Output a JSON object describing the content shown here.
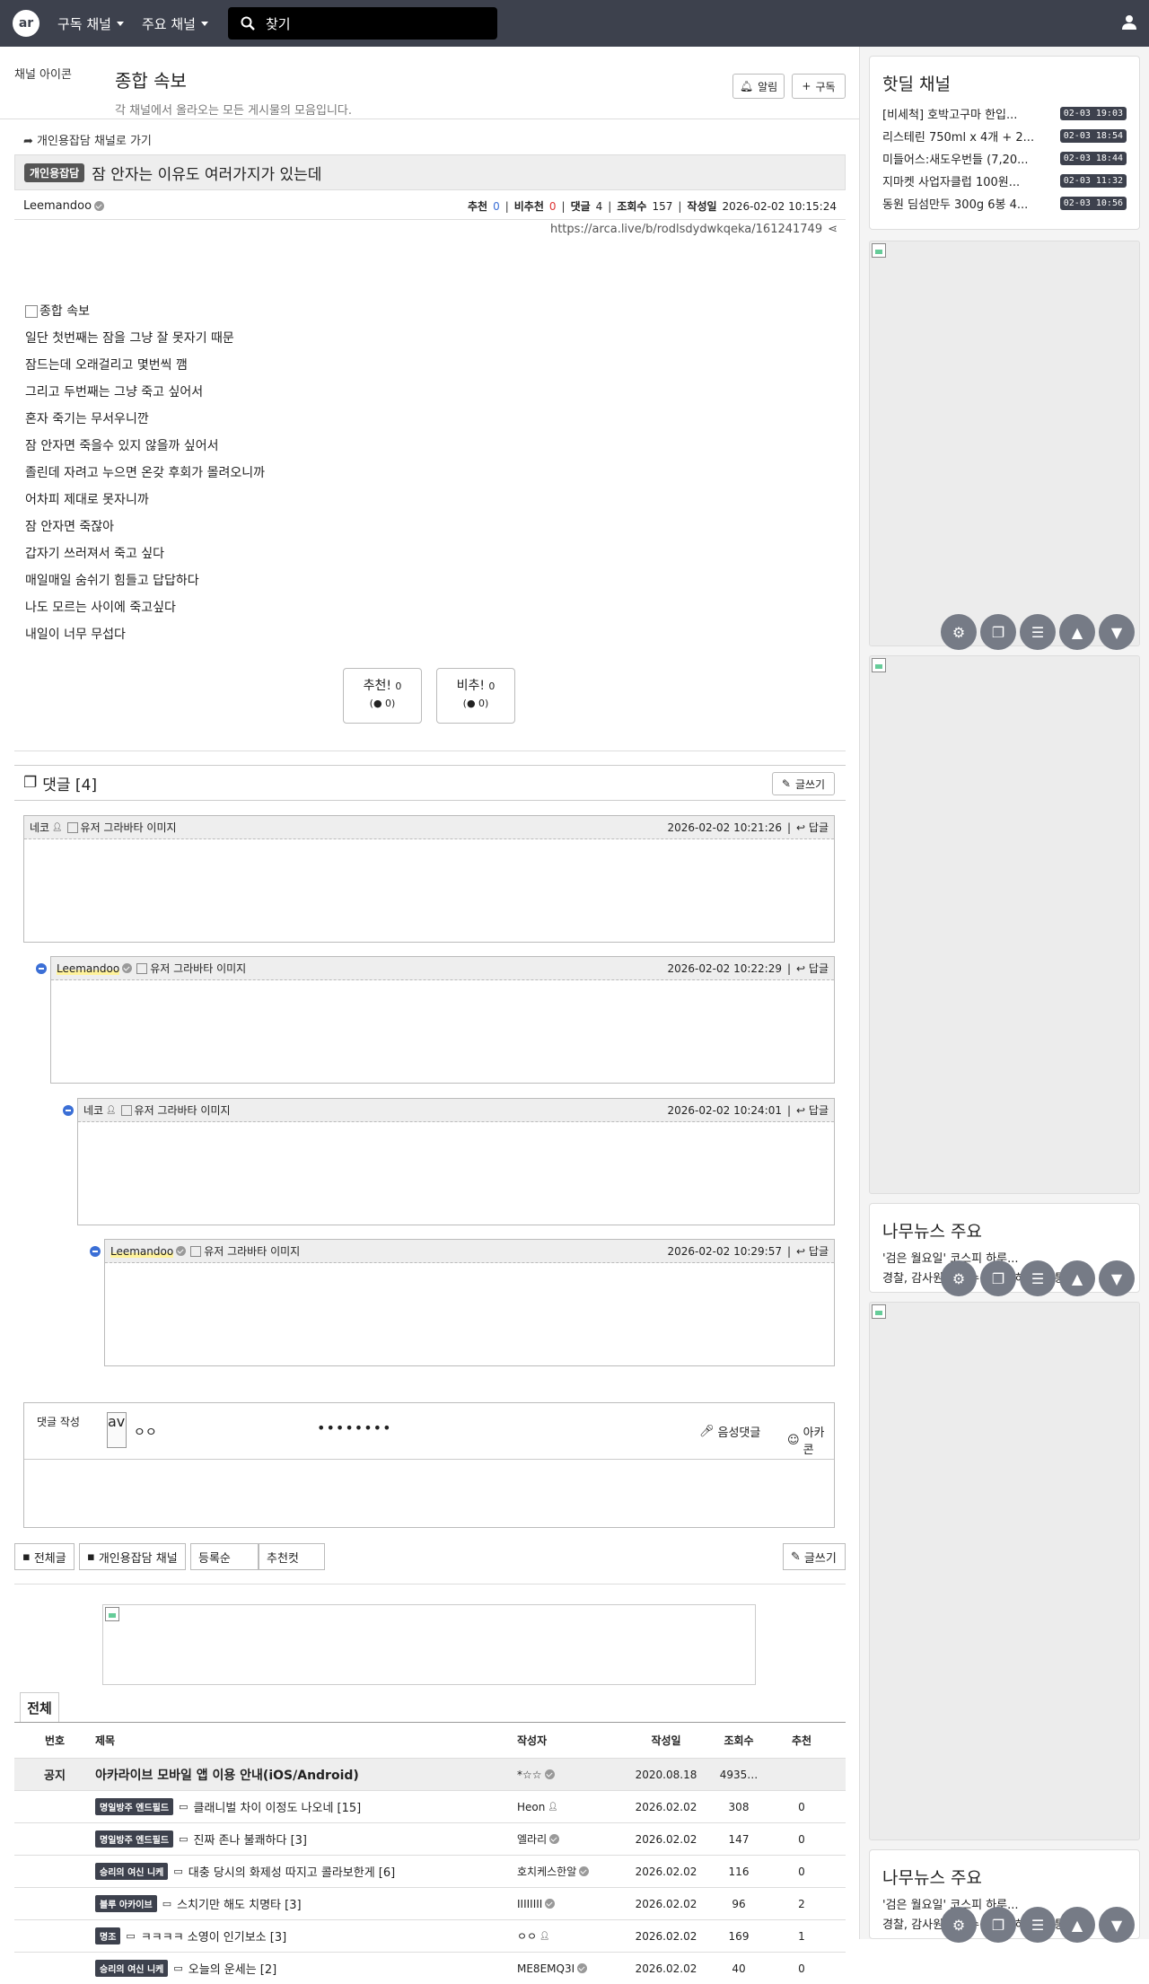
{
  "topbar": {
    "logo": "ar",
    "nav1": "구독 채널",
    "nav2": "주요 채널",
    "search_placeholder": "찾기"
  },
  "channel": {
    "img_alt": "채널 아이콘",
    "title": "종합 속보",
    "desc": "각 채널에서 올라오는 모든 게시물의 모음입니다.",
    "alarm": "알림",
    "subscribe": "구독"
  },
  "post": {
    "back_link": "개인용잡담 채널로 가기",
    "category": "개인용잡담",
    "title": "잠 안자는 이유도 여러가지가 있는데",
    "author": "Leemandoo",
    "labels": {
      "rec": "추천",
      "unrec": "비추천",
      "comments": "댓글",
      "views": "조회수",
      "date": "작성일"
    },
    "rec": "0",
    "unrec": "0",
    "comments": "4",
    "views": "157",
    "date": "2026-02-02 10:15:24",
    "url": "https://arca.live/b/rodlsdydwkqeka/161241749",
    "img_alt": "종합 속보",
    "lines": [
      "일단 첫번째는 잠을 그냥 잘 못자기 때문",
      "잠드는데 오래걸리고 몇번씩 깸",
      "그리고 두번째는 그냥 죽고 싶어서",
      "혼자 죽기는 무서우니깐",
      "잠 안자면 죽을수 있지 않을까 싶어서",
      "졸린데 자려고 누으면 온갖 후회가 몰려오니까",
      "어차피 제대로 못자니까",
      "잠 안자면 죽잖아",
      "갑자기 쓰러져서 죽고 싶다",
      "매일매일 숨쉬기 힘들고 답답하다",
      "나도 모르는 사이에 죽고싶다",
      "내일이 너무 무섭다"
    ],
    "vote_up": "추천!",
    "vote_up_n": "0",
    "vote_up_sub": "0",
    "vote_down": "비추!",
    "vote_down_n": "0",
    "vote_down_sub": "0"
  },
  "comments": {
    "header": "댓글 [4]",
    "write_btn": "글쓰기",
    "reply": "답글",
    "avatar_alt": "유저 그라바타 이미지",
    "items": [
      {
        "name": "네코",
        "time": "2026-02-02 10:21:26"
      },
      {
        "name": "Leemandoo",
        "time": "2026-02-02 10:22:29"
      },
      {
        "name": "네코",
        "time": "2026-02-02 10:24:01"
      },
      {
        "name": "Leemandoo",
        "time": "2026-02-02 10:29:57"
      }
    ]
  },
  "write": {
    "label": "댓글 작성",
    "avatar_alt": "av",
    "nick": "ㅇㅇ",
    "password": "••••••••",
    "voice": "음성댓글",
    "arcacon": "아카콘"
  },
  "filters": {
    "all": "전체글",
    "channel": "개인용잡담 채널",
    "order": "등록순",
    "best": "추천컷",
    "write": "글쓰기"
  },
  "board": {
    "tab": "전체",
    "cols": {
      "no": "번호",
      "title": "제목",
      "author": "작성자",
      "date": "작성일",
      "views": "조회수",
      "rec": "추천"
    },
    "notice": {
      "no": "공지",
      "title": "아카라이브 모바일 앱 이용 안내(iOS/Android)",
      "author": "*☆☆",
      "date": "2020.08.18",
      "views": "4935…",
      "rec": ""
    },
    "rows": [
      {
        "cat": "명일방주 엔드필드",
        "title": "클래니벌 차이 이정도 나오네 [15]",
        "author": "Heon",
        "date": "2026.02.02",
        "views": "308",
        "rec": "0"
      },
      {
        "cat": "명일방주 엔드필드",
        "title": "진짜 존나 불쾌하다 [3]",
        "author": "엘라리",
        "date": "2026.02.02",
        "views": "147",
        "rec": "0"
      },
      {
        "cat": "승리의 여신 니케",
        "title": "대충 당시의 화제성 따지고 콜라보한게 [6]",
        "author": "호치케스한알",
        "date": "2026.02.02",
        "views": "116",
        "rec": "0"
      },
      {
        "cat": "블루 아카이브",
        "title": "스치기만 해도 치명타 [3]",
        "author": "IIIIIIII",
        "date": "2026.02.02",
        "views": "96",
        "rec": "2"
      },
      {
        "cat": "명조",
        "title": "ㅋㅋㅋㅋ 소영이 인기보소 [3]",
        "author": "ㅇㅇ",
        "date": "2026.02.02",
        "views": "169",
        "rec": "1"
      },
      {
        "cat": "승리의 여신 니케",
        "title": "오늘의 운세는 [2]",
        "author": "ME8EMQ3I",
        "date": "2026.02.02",
        "views": "40",
        "rec": "0"
      }
    ]
  },
  "sidebar": {
    "hotdeal_title": "핫딜 채널",
    "hotdeals": [
      {
        "t": "[비세척] 호박고구마 한입...",
        "d": "02-03 19:03"
      },
      {
        "t": "리스테린 750ml x 4개 + 2...",
        "d": "02-03 18:54"
      },
      {
        "t": "미들어스:새도우번들 (7,20...",
        "d": "02-03 18:44"
      },
      {
        "t": "지마켓 사업자클럽 100원...",
        "d": "02-03 11:32"
      },
      {
        "t": "동원 딤섬만두 300g 6봉 4...",
        "d": "02-03 10:56"
      }
    ],
    "news_title": "나무뉴스 주요",
    "news": [
      "'검은 월요일' 코스피 하루...",
      "경찰, 감사원 압수수색...'서해피격' 통기..."
    ]
  }
}
